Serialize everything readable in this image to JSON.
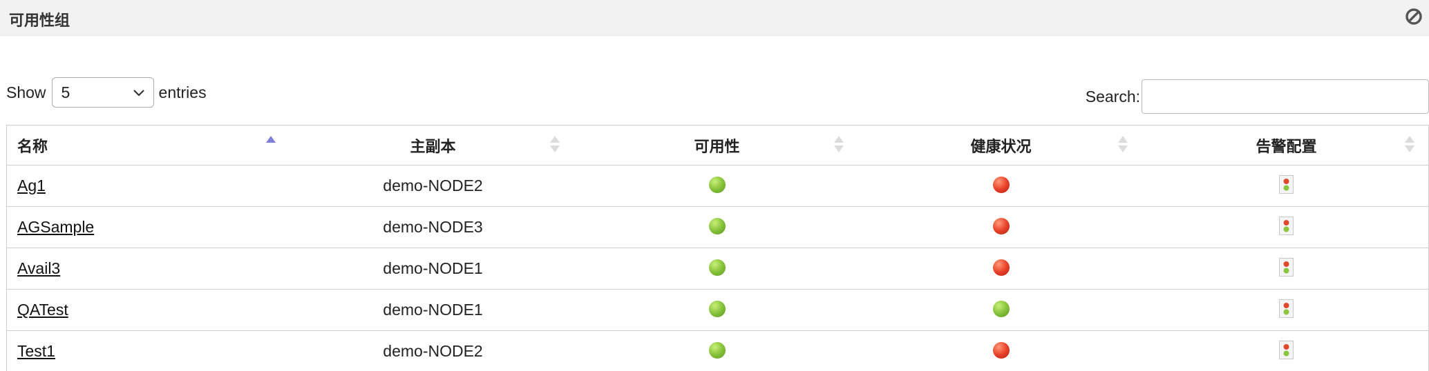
{
  "panel": {
    "title": "可用性组"
  },
  "length": {
    "show": "Show",
    "selected": "5",
    "entries": "entries"
  },
  "search": {
    "label": "Search:",
    "value": ""
  },
  "table": {
    "headers": [
      "名称",
      "主副本",
      "可用性",
      "健康状况",
      "告警配置"
    ],
    "sorted_column": 0,
    "sort_direction": "ascending",
    "rows": [
      {
        "name": "Ag1",
        "primary": "demo-NODE2",
        "availability": "green",
        "health": "red",
        "alert": "alert-config-icon"
      },
      {
        "name": "AGSample",
        "primary": "demo-NODE3",
        "availability": "green",
        "health": "red",
        "alert": "alert-config-icon"
      },
      {
        "name": "Avail3",
        "primary": "demo-NODE1",
        "availability": "green",
        "health": "red",
        "alert": "alert-config-icon"
      },
      {
        "name": "QATest",
        "primary": "demo-NODE1",
        "availability": "green",
        "health": "green",
        "alert": "alert-config-icon"
      },
      {
        "name": "Test1",
        "primary": "demo-NODE2",
        "availability": "green",
        "health": "red",
        "alert": "alert-config-icon"
      }
    ]
  }
}
